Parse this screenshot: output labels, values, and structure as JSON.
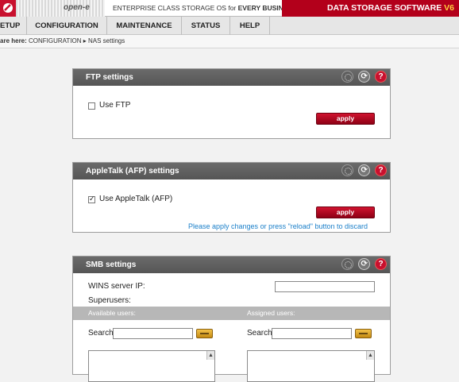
{
  "header": {
    "brand": "open-e",
    "tagline_prefix": "ENTERPRISE CLASS STORAGE OS for ",
    "tagline_bold": "EVERY BUSINESS",
    "product": "DATA STORAGE SOFTWARE ",
    "product_version": "V6"
  },
  "nav": {
    "setup": "ETUP",
    "configuration": "CONFIGURATION",
    "maintenance": "MAINTENANCE",
    "status": "STATUS",
    "help": "HELP"
  },
  "breadcrumb": {
    "prefix": "are here:",
    "path": " CONFIGURATION ▸ NAS settings"
  },
  "ftp": {
    "title": "FTP settings",
    "checkbox_label": "Use FTP",
    "checked": false,
    "apply": "apply"
  },
  "afp": {
    "title": "AppleTalk (AFP) settings",
    "checkbox_label": "Use AppleTalk (AFP)",
    "checked": true,
    "apply": "apply",
    "note": "Please apply changes or press \"reload\" button to discard"
  },
  "smb": {
    "title": "SMB settings",
    "wins_label": "WINS server IP:",
    "wins_value": "",
    "superusers_label": "Superusers:",
    "available_users": "Available users:",
    "assigned_users": "Assigned users:",
    "search_label_left": "Search",
    "search_label_right": "Search",
    "search_value_left": "",
    "search_value_right": ""
  },
  "icons": {
    "settings": "settings-icon",
    "reload": "reload-icon",
    "help": "help-icon"
  },
  "colors": {
    "accent_red": "#b3001b",
    "panel_header": "#5f5f5f",
    "note_blue": "#1a7fc9"
  }
}
